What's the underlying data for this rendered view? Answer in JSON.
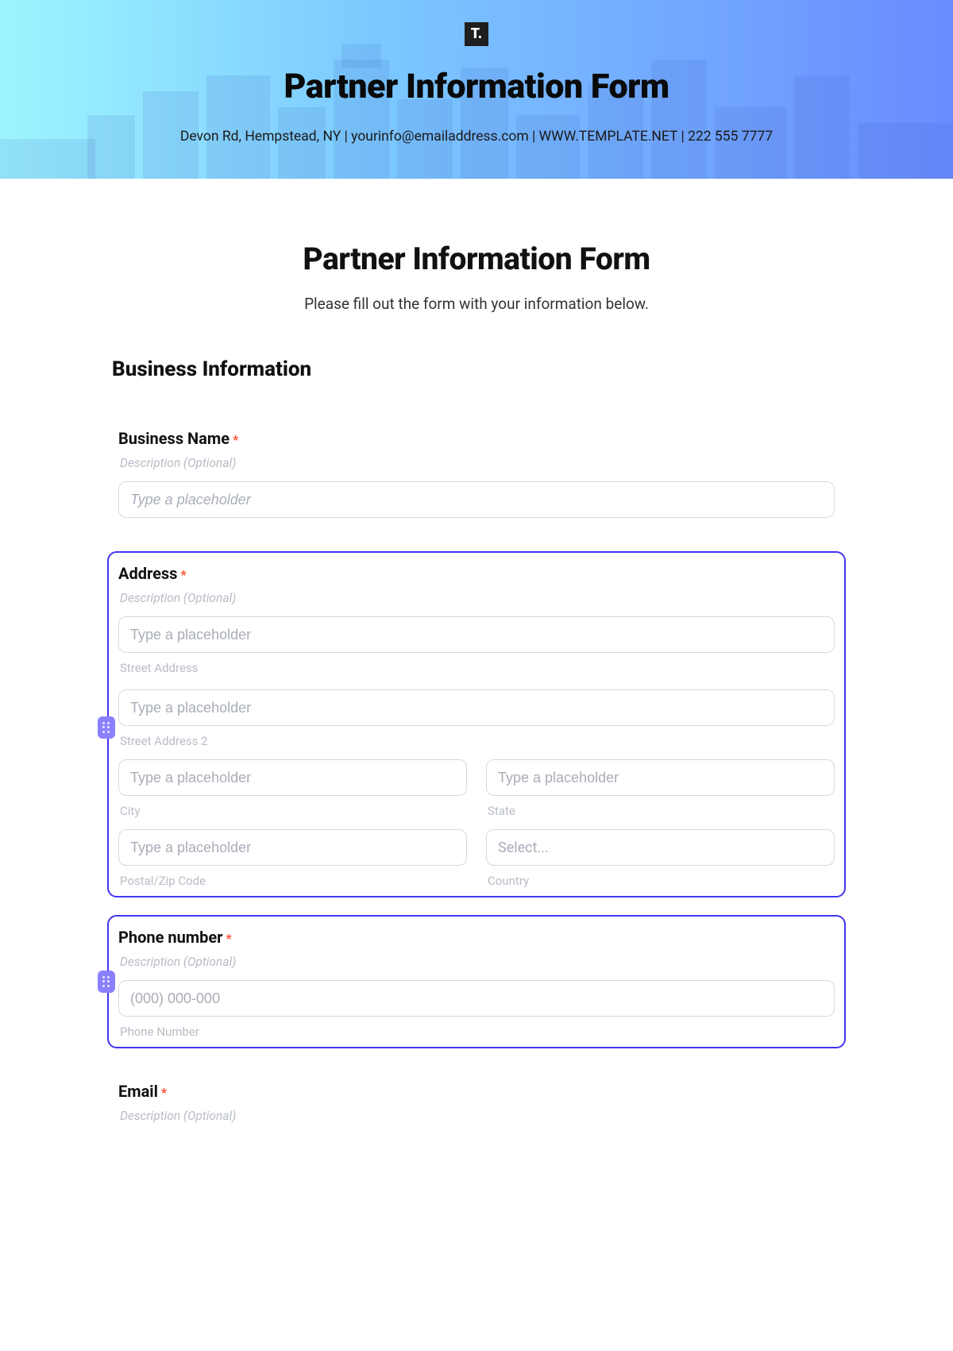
{
  "banner": {
    "logo_text": "T.",
    "title": "Partner Information Form",
    "subtitle": "Devon Rd, Hempstead, NY | yourinfo@emailaddress.com | WWW.TEMPLATE.NET | 222 555 7777"
  },
  "form": {
    "title": "Partner Information Form",
    "subtitle": "Please fill out the form with your information below.",
    "section_heading": "Business Information"
  },
  "fields": {
    "business_name": {
      "label": "Business Name",
      "required_mark": "*",
      "description": "Description (Optional)",
      "placeholder": "Type a placeholder"
    },
    "address": {
      "label": "Address",
      "required_mark": "*",
      "description": "Description (Optional)",
      "street": {
        "placeholder": "Type a placeholder",
        "sublabel": "Street Address"
      },
      "street2": {
        "placeholder": "Type a placeholder",
        "sublabel": "Street Address 2"
      },
      "city": {
        "placeholder": "Type a placeholder",
        "sublabel": "City"
      },
      "state": {
        "placeholder": "Type a placeholder",
        "sublabel": "State"
      },
      "postal": {
        "placeholder": "Type a placeholder",
        "sublabel": "Postal/Zip Code"
      },
      "country": {
        "placeholder": "Select...",
        "sublabel": "Country"
      }
    },
    "phone": {
      "label": "Phone number",
      "required_mark": "*",
      "description": "Description (Optional)",
      "placeholder": "(000) 000-000",
      "sublabel": "Phone Number"
    },
    "email": {
      "label": "Email",
      "required_mark": "*",
      "description": "Description (Optional)"
    }
  }
}
